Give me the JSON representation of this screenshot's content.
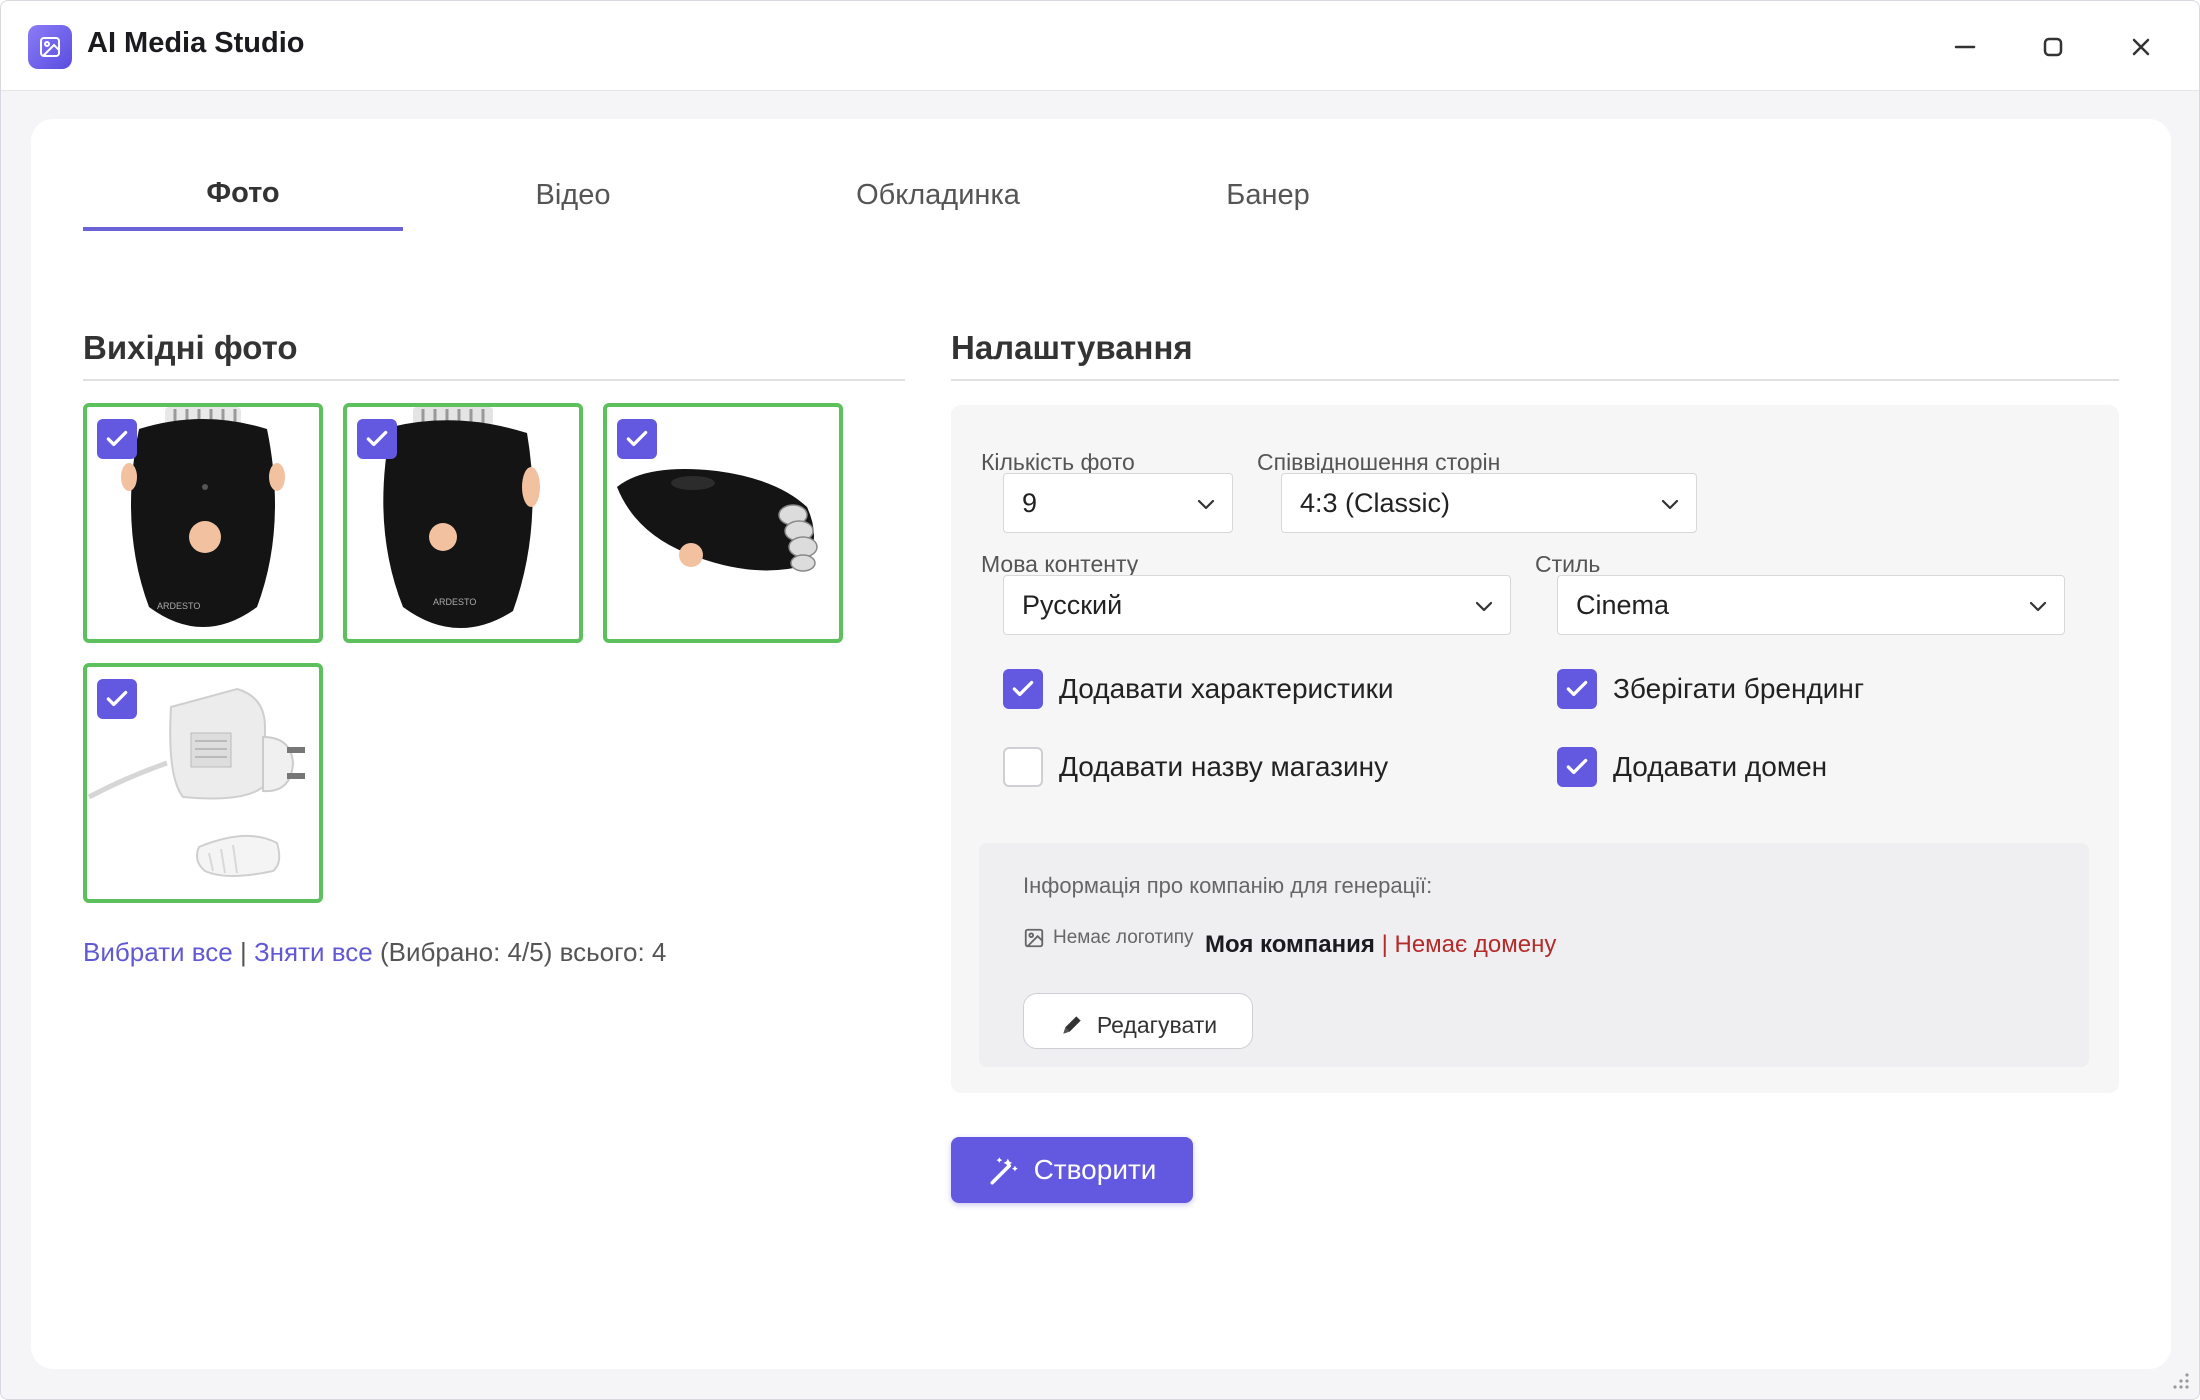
{
  "window": {
    "title": "AI Media Studio"
  },
  "tabs": [
    {
      "label": "Фото",
      "active": true
    },
    {
      "label": "Відео",
      "active": false
    },
    {
      "label": "Обкладинка",
      "active": false
    },
    {
      "label": "Банер",
      "active": false
    }
  ],
  "source_photos": {
    "title": "Вихідні фото",
    "photos": [
      {
        "subject": "epilator-front",
        "checked": true
      },
      {
        "subject": "epilator-angle",
        "checked": true
      },
      {
        "subject": "epilator-side",
        "checked": true
      },
      {
        "subject": "power-adapter-brush",
        "checked": true
      }
    ],
    "select_all": "Вибрати все",
    "separator": " | ",
    "deselect_all": "Зняти все",
    "summary": " (Вибрано: 4/5) всього: 4"
  },
  "settings": {
    "title": "Налаштування",
    "photo_count": {
      "label": "Кількість фото",
      "value": "9"
    },
    "aspect_ratio": {
      "label": "Співвідношення сторін",
      "value": "4:3 (Classic)"
    },
    "content_language": {
      "label": "Мова контенту",
      "value": "Русский"
    },
    "style": {
      "label": "Стиль",
      "value": "Cinema"
    },
    "checkboxes": {
      "add_specs": {
        "label": "Додавати характеристики",
        "checked": true
      },
      "keep_branding": {
        "label": "Зберігати брендинг",
        "checked": true
      },
      "add_store_name": {
        "label": "Додавати назву магазину",
        "checked": false
      },
      "add_domain": {
        "label": "Додавати домен",
        "checked": true
      }
    },
    "company": {
      "heading": "Інформація про компанію для генерації:",
      "no_logo": "Немає логотипу",
      "name": "Моя компания",
      "separator": " | ",
      "no_domain": "Немає домену",
      "edit_label": "Редагувати"
    }
  },
  "create_button": {
    "label": "Створити"
  },
  "colors": {
    "accent": "#6359e0",
    "selected_border": "#5cc05c",
    "error_text": "#b52a2a"
  }
}
